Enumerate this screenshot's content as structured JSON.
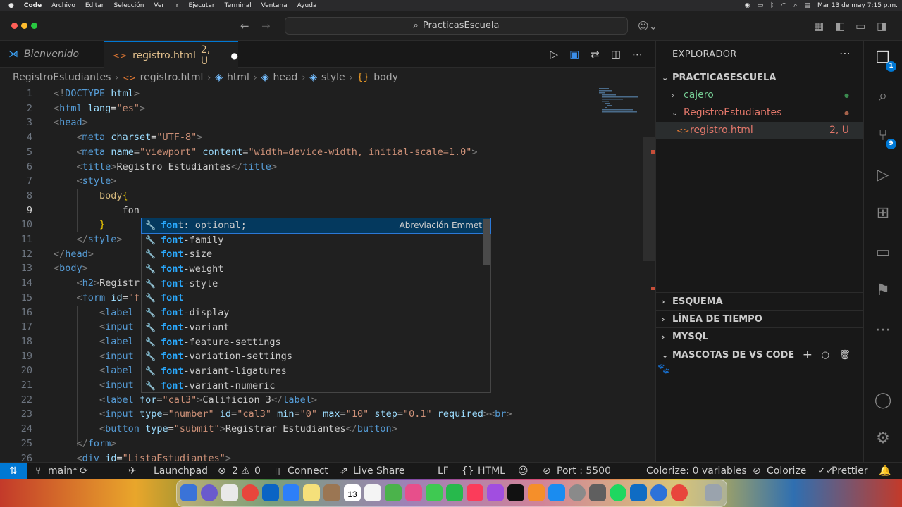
{
  "menubar": {
    "apple": "",
    "items": [
      "Code",
      "Archivo",
      "Editar",
      "Selección",
      "Ver",
      "Ir",
      "Ejecutar",
      "Terminal",
      "Ventana",
      "Ayuda"
    ],
    "clock": "Mar 13 de may  7:15 p.m."
  },
  "titlebar": {
    "search_text": "PracticasEscuela"
  },
  "tabs": [
    {
      "label": "Bienvenido"
    },
    {
      "label": "registro.html",
      "status": "2, U"
    }
  ],
  "breadcrumbs": [
    "RegistroEstudiantes",
    "registro.html",
    "html",
    "head",
    "style",
    "body"
  ],
  "code_lines": [
    {
      "n": "1",
      "html": "<span class='t-punct'>&lt;!</span><span class='t-doc'>DOCTYPE</span> <span class='t-attr'>html</span><span class='t-punct'>&gt;</span>"
    },
    {
      "n": "2",
      "html": "<span class='t-punct'>&lt;</span><span class='t-tag'>html</span> <span class='t-attr'>lang</span>=<span class='t-str'>\"es\"</span><span class='t-punct'>&gt;</span>"
    },
    {
      "n": "3",
      "html": "<span class='t-punct'>&lt;</span><span class='t-tag'>head</span><span class='t-punct'>&gt;</span>"
    },
    {
      "n": "4",
      "html": "    <span class='t-punct'>&lt;</span><span class='t-tag'>meta</span> <span class='t-attr'>charset</span>=<span class='t-str'>\"UTF-8\"</span><span class='t-punct'>&gt;</span>"
    },
    {
      "n": "5",
      "html": "    <span class='t-punct'>&lt;</span><span class='t-tag'>meta</span> <span class='t-attr'>name</span>=<span class='t-str'>\"viewport\"</span> <span class='t-attr'>content</span>=<span class='t-str'>\"width=device-width, initial-scale=1.0\"</span><span class='t-punct'>&gt;</span>"
    },
    {
      "n": "6",
      "html": "    <span class='t-punct'>&lt;</span><span class='t-tag'>title</span><span class='t-punct'>&gt;</span>Registro Estudiantes<span class='t-punct'>&lt;/</span><span class='t-tag'>title</span><span class='t-punct'>&gt;</span>"
    },
    {
      "n": "7",
      "html": "    <span class='t-punct'>&lt;</span><span class='t-tag'>style</span><span class='t-punct'>&gt;</span>"
    },
    {
      "n": "8",
      "html": "        <span class='t-sel'>body</span><span style='color:#ffd700'>{</span>"
    },
    {
      "n": "9",
      "html": "            fon"
    },
    {
      "n": "10",
      "html": "        <span style='color:#ffd700'>}</span>"
    },
    {
      "n": "11",
      "html": "    <span class='t-punct'>&lt;/</span><span class='t-tag'>style</span><span class='t-punct'>&gt;</span>"
    },
    {
      "n": "12",
      "html": "<span class='t-punct'>&lt;/</span><span class='t-tag'>head</span><span class='t-punct'>&gt;</span>"
    },
    {
      "n": "13",
      "html": "<span class='t-punct'>&lt;</span><span class='t-tag'>body</span><span class='t-punct'>&gt;</span>"
    },
    {
      "n": "14",
      "html": "    <span class='t-punct'>&lt;</span><span class='t-tag'>h2</span><span class='t-punct'>&gt;</span>Registr"
    },
    {
      "n": "15",
      "html": "    <span class='t-punct'>&lt;</span><span class='t-tag'>form</span> <span class='t-attr'>id</span>=<span class='t-str'>\"f</span>"
    },
    {
      "n": "16",
      "html": "        <span class='t-punct'>&lt;</span><span class='t-tag'>label</span>"
    },
    {
      "n": "17",
      "html": "        <span class='t-punct'>&lt;</span><span class='t-tag'>input</span>"
    },
    {
      "n": "18",
      "html": "        <span class='t-punct'>&lt;</span><span class='t-tag'>label</span>"
    },
    {
      "n": "19",
      "html": "        <span class='t-punct'>&lt;</span><span class='t-tag'>input</span>                                                    <span class='t-attr'>d</span><span class='t-punct'>&gt;&lt;</span><span class='t-tag'>br</span><span class='t-punct'>&gt;</span>"
    },
    {
      "n": "20",
      "html": "        <span class='t-punct'>&lt;</span><span class='t-tag'>label</span>"
    },
    {
      "n": "21",
      "html": "        <span class='t-punct'>&lt;</span><span class='t-tag'>input</span>                                                    <span class='t-attr'>d</span><span class='t-punct'>&gt;&lt;</span><span class='t-tag'>br</span><span class='t-punct'>&gt;</span>"
    },
    {
      "n": "22",
      "html": "        <span class='t-punct'>&lt;</span><span class='t-tag'>label</span> <span class='t-attr'>for</span>=<span class='t-str'>\"cal3\"</span><span class='t-punct'>&gt;</span>Calificion 3<span class='t-punct'>&lt;/</span><span class='t-tag'>label</span><span class='t-punct'>&gt;</span>"
    },
    {
      "n": "23",
      "html": "        <span class='t-punct'>&lt;</span><span class='t-tag'>input</span> <span class='t-attr'>type</span>=<span class='t-str'>\"number\"</span> <span class='t-attr'>id</span>=<span class='t-str'>\"cal3\"</span> <span class='t-attr'>min</span>=<span class='t-str'>\"0\"</span> <span class='t-attr'>max</span>=<span class='t-str'>\"10\"</span> <span class='t-attr'>step</span>=<span class='t-str'>\"0.1\"</span> <span class='t-attr'>required</span><span class='t-punct'>&gt;&lt;</span><span class='t-tag'>br</span><span class='t-punct'>&gt;</span>"
    },
    {
      "n": "24",
      "html": "        <span class='t-punct'>&lt;</span><span class='t-tag'>button</span> <span class='t-attr'>type</span>=<span class='t-str'>\"submit\"</span><span class='t-punct'>&gt;</span>Registrar Estudiantes<span class='t-punct'>&lt;/</span><span class='t-tag'>button</span><span class='t-punct'>&gt;</span>"
    },
    {
      "n": "25",
      "html": "    <span class='t-punct'>&lt;/</span><span class='t-tag'>form</span><span class='t-punct'>&gt;</span>"
    },
    {
      "n": "26",
      "html": "    <span class='t-punct'>&lt;</span><span class='t-tag'>div</span> <span class='t-attr'>id</span>=<span class='t-str'>\"ListaEstudiantes\"</span><span class='t-punct'>&gt;</span>"
    }
  ],
  "active_line": "9",
  "suggestions": [
    {
      "match": "fon",
      "rest": "t: optional;",
      "detail": "Abreviación Emmet"
    },
    {
      "match": "font",
      "rest": "-family"
    },
    {
      "match": "font",
      "rest": "-size"
    },
    {
      "match": "font",
      "rest": "-weight"
    },
    {
      "match": "font",
      "rest": "-style"
    },
    {
      "match": "font",
      "rest": ""
    },
    {
      "match": "font",
      "rest": "-display"
    },
    {
      "match": "font",
      "rest": "-variant"
    },
    {
      "match": "font",
      "rest": "-feature-settings"
    },
    {
      "match": "font",
      "rest": "-variation-settings"
    },
    {
      "match": "font",
      "rest": "-variant-ligatures"
    },
    {
      "match": "font",
      "rest": "-variant-numeric"
    }
  ],
  "explorer": {
    "title": "EXPLORADOR",
    "root": "PRACTICASESCUELA",
    "items": [
      {
        "label": "cajero",
        "kind": "folder",
        "color": "#73c991",
        "dot": "#3b8a4f"
      },
      {
        "label": "RegistroEstudiantes",
        "kind": "folder-open",
        "color": "#e2776a",
        "dot": "#a5614a"
      },
      {
        "label": "registro.html",
        "kind": "file",
        "color": "#e2776a",
        "status": "2, U"
      }
    ],
    "sections": [
      "ESQUEMA",
      "LÍNEA DE TIEMPO",
      "MYSQL",
      "MASCOTAS DE VS CODE"
    ]
  },
  "activity": {
    "explorer_badge": "1",
    "scm_badge": "9"
  },
  "statusbar": {
    "branch": "main*",
    "launchpad": "Launchpad",
    "errors": "2",
    "warnings": "0",
    "connect": "Connect",
    "liveshare": "Live Share",
    "eol": "LF",
    "language": "HTML",
    "port": "Port : 5500",
    "colorize_vars": "Colorize: 0 variables",
    "colorize": "Colorize",
    "prettier": "Prettier"
  },
  "dock": {
    "calendar_day": "13"
  }
}
